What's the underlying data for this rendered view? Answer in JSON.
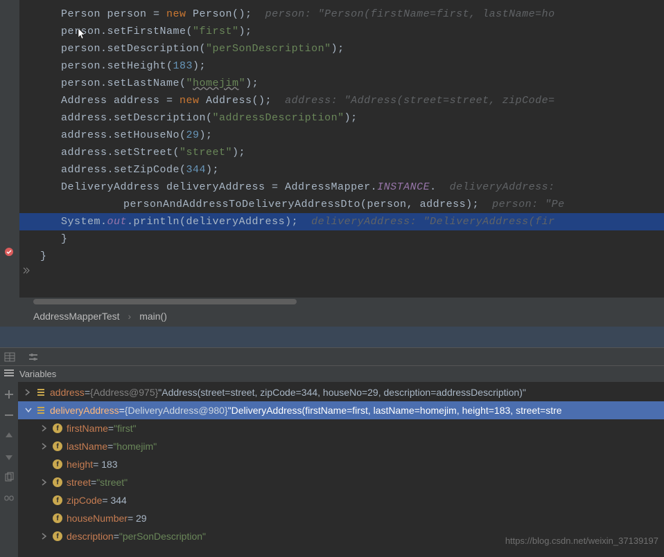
{
  "code": {
    "lines": [
      {
        "tokens": [
          {
            "t": "Person person = ",
            "c": ""
          },
          {
            "t": "new",
            "c": "kw"
          },
          {
            "t": " Person();  ",
            "c": ""
          },
          {
            "t": "person: \"Person(firstName=first, lastName=ho",
            "c": "hint"
          }
        ]
      },
      {
        "tokens": [
          {
            "t": "person.setFirstName(",
            "c": ""
          },
          {
            "t": "\"first\"",
            "c": "str"
          },
          {
            "t": ");",
            "c": ""
          }
        ]
      },
      {
        "tokens": [
          {
            "t": "person.setDescription(",
            "c": ""
          },
          {
            "t": "\"perSonDescription\"",
            "c": "str"
          },
          {
            "t": ");",
            "c": ""
          }
        ]
      },
      {
        "tokens": [
          {
            "t": "person.setHeight(",
            "c": ""
          },
          {
            "t": "183",
            "c": "num"
          },
          {
            "t": ");",
            "c": ""
          }
        ]
      },
      {
        "tokens": [
          {
            "t": "person.setLastName(",
            "c": ""
          },
          {
            "t": "\"",
            "c": "str"
          },
          {
            "t": "homejim",
            "c": "str warn-underline"
          },
          {
            "t": "\"",
            "c": "str"
          },
          {
            "t": ");",
            "c": ""
          }
        ]
      },
      {
        "tokens": [
          {
            "t": "",
            "c": ""
          }
        ]
      },
      {
        "tokens": [
          {
            "t": "Address address = ",
            "c": ""
          },
          {
            "t": "new",
            "c": "kw"
          },
          {
            "t": " Address();  ",
            "c": ""
          },
          {
            "t": "address: \"Address(street=street, zipCode=",
            "c": "hint"
          }
        ]
      },
      {
        "tokens": [
          {
            "t": "address.setDescription(",
            "c": ""
          },
          {
            "t": "\"addressDescription\"",
            "c": "str"
          },
          {
            "t": ");",
            "c": ""
          }
        ]
      },
      {
        "tokens": [
          {
            "t": "address.setHouseNo(",
            "c": ""
          },
          {
            "t": "29",
            "c": "num"
          },
          {
            "t": ");",
            "c": ""
          }
        ]
      },
      {
        "tokens": [
          {
            "t": "address.setStreet(",
            "c": ""
          },
          {
            "t": "\"street\"",
            "c": "str"
          },
          {
            "t": ");",
            "c": ""
          }
        ]
      },
      {
        "tokens": [
          {
            "t": "address.setZipCode(",
            "c": ""
          },
          {
            "t": "344",
            "c": "num"
          },
          {
            "t": ");",
            "c": ""
          }
        ]
      },
      {
        "tokens": [
          {
            "t": "",
            "c": ""
          }
        ]
      },
      {
        "tokens": [
          {
            "t": "DeliveryAddress deliveryAddress = AddressMapper.",
            "c": ""
          },
          {
            "t": "INSTANCE",
            "c": "static-const"
          },
          {
            "t": ".  ",
            "c": ""
          },
          {
            "t": "deliveryAddress:",
            "c": "hint"
          }
        ]
      },
      {
        "indent": 2,
        "tokens": [
          {
            "t": "personAndAddressToDeliveryAddressDto(person, address);  ",
            "c": ""
          },
          {
            "t": "person: \"Pe",
            "c": "hint"
          }
        ]
      },
      {
        "hl": true,
        "tokens": [
          {
            "t": "System.",
            "c": ""
          },
          {
            "t": "out",
            "c": "static-f"
          },
          {
            "t": ".println(deliveryAddress);  ",
            "c": ""
          },
          {
            "t": "deliveryAddress: \"DeliveryAddress(fir",
            "c": "hint"
          }
        ]
      },
      {
        "indent": 0,
        "pad": 30,
        "tokens": [
          {
            "t": "}",
            "c": ""
          }
        ]
      },
      {
        "indent": 0,
        "pad": 0,
        "tokens": [
          {
            "t": "}",
            "c": ""
          }
        ]
      }
    ]
  },
  "breadcrumb": {
    "class": "AddressMapperTest",
    "method": "main()"
  },
  "variables_title": "Variables",
  "vars": {
    "address": {
      "name": "address",
      "meta": "{Address@975}",
      "value": "\"Address(street=street, zipCode=344, houseNo=29, description=addressDescription)\""
    },
    "deliveryAddress": {
      "name": "deliveryAddress",
      "meta": "{DeliveryAddress@980}",
      "value": "\"DeliveryAddress(firstName=first, lastName=homejim, height=183, street=stre"
    },
    "children": [
      {
        "name": "firstName",
        "eq": " = ",
        "value": "\"first\"",
        "type": "str",
        "chev": true
      },
      {
        "name": "lastName",
        "eq": " = ",
        "value": "\"homejim\"",
        "type": "str",
        "chev": true
      },
      {
        "name": "height",
        "eq": " = 183",
        "value": "",
        "type": "num",
        "chev": false
      },
      {
        "name": "street",
        "eq": " = ",
        "value": "\"street\"",
        "type": "str",
        "chev": true
      },
      {
        "name": "zipCode",
        "eq": " = 344",
        "value": "",
        "type": "num",
        "chev": false
      },
      {
        "name": "houseNumber",
        "eq": " = 29",
        "value": "",
        "type": "num",
        "chev": false
      },
      {
        "name": "description",
        "eq": " = ",
        "value": "\"perSonDescription\"",
        "type": "str",
        "chev": true
      }
    ]
  },
  "watermark": "https://blog.csdn.net/weixin_37139197"
}
